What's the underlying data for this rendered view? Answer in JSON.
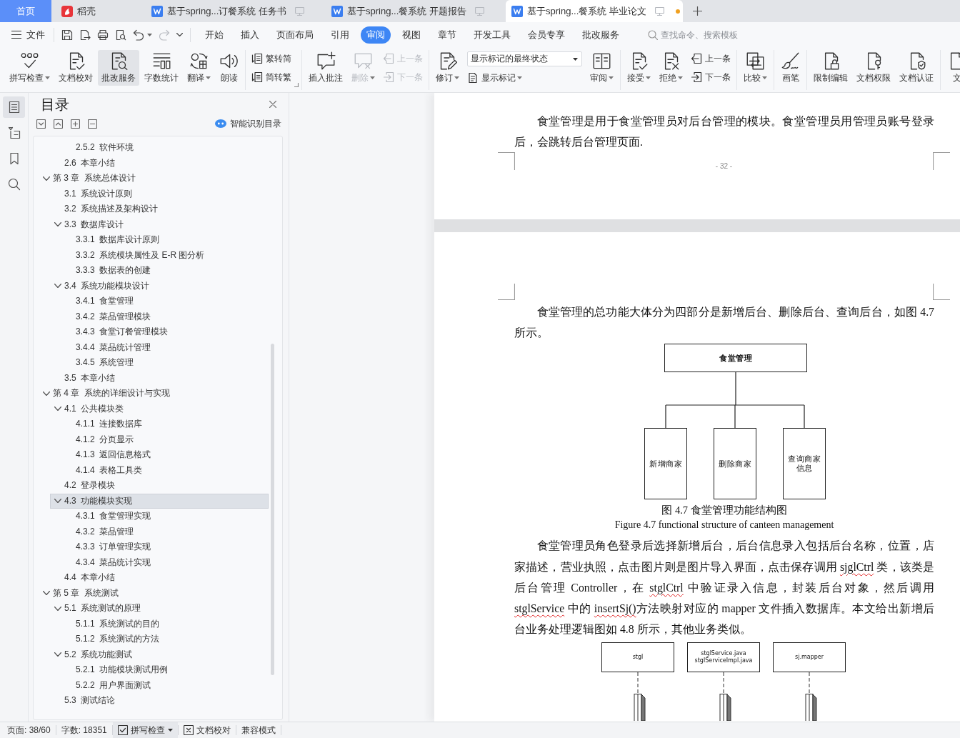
{
  "tabs": [
    {
      "kind": "home",
      "label": "首页",
      "selected": false
    },
    {
      "kind": "docer",
      "label": "稻壳",
      "selected": false
    },
    {
      "kind": "document",
      "label": "基于spring...订餐系统 任务书",
      "selected": false,
      "modified": false
    },
    {
      "kind": "document",
      "label": "基于spring...餐系统 开题报告",
      "selected": false,
      "modified": false
    },
    {
      "kind": "document",
      "label": "基于spring...餐系统 毕业论文",
      "selected": true,
      "modified": true
    }
  ],
  "menu": {
    "file": "文件",
    "quick_access": [
      {
        "dropdown": false,
        "disabled": false
      },
      {
        "dropdown": false,
        "disabled": false
      },
      {
        "dropdown": false,
        "disabled": false
      },
      {
        "dropdown": false,
        "disabled": false
      },
      {
        "dropdown": true,
        "disabled": false
      },
      {
        "dropdown": false,
        "disabled": true
      }
    ],
    "tabs": [
      {
        "label": "开始",
        "selected": false
      },
      {
        "label": "插入",
        "selected": false
      },
      {
        "label": "页面布局",
        "selected": false
      },
      {
        "label": "引用",
        "selected": false
      },
      {
        "label": "审阅",
        "selected": true
      },
      {
        "label": "视图",
        "selected": false
      },
      {
        "label": "章节",
        "selected": false
      },
      {
        "label": "开发工具",
        "selected": false
      },
      {
        "label": "会员专享",
        "selected": false
      },
      {
        "label": "批改服务",
        "selected": false
      }
    ],
    "search": {
      "placeholder": "查找命令、搜索模板"
    }
  },
  "ribbon": {
    "groups": [
      {
        "launcher": false,
        "items": [
          {
            "kind": "large",
            "label": "拼写检查",
            "dropdown": true,
            "disabled": false,
            "hovered": false
          },
          {
            "kind": "large",
            "label": "文档校对",
            "dropdown": false,
            "disabled": false,
            "hovered": false
          },
          {
            "kind": "large",
            "label": "批改服务",
            "dropdown": false,
            "disabled": false,
            "hovered": true
          },
          {
            "kind": "large",
            "label": "字数统计",
            "dropdown": false,
            "disabled": false,
            "hovered": false
          },
          {
            "kind": "large",
            "label": "翻译",
            "dropdown": true,
            "disabled": false,
            "hovered": false
          },
          {
            "kind": "large",
            "label": "朗读",
            "dropdown": false,
            "disabled": false,
            "hovered": false
          }
        ]
      },
      {
        "launcher": true,
        "items": [
          {
            "kind": "stack",
            "items": [
              {
                "kind": "small",
                "label": "繁转简",
                "dropdown": false,
                "disabled": false,
                "hovered": false
              },
              {
                "kind": "small",
                "label": "简转繁",
                "dropdown": false,
                "disabled": false,
                "hovered": false
              }
            ]
          }
        ]
      },
      {
        "launcher": false,
        "items": [
          {
            "kind": "large",
            "label": "插入批注",
            "dropdown": false,
            "disabled": false,
            "hovered": false
          },
          {
            "kind": "large",
            "label": "删除",
            "dropdown": true,
            "disabled": true,
            "hovered": false
          },
          {
            "kind": "stack",
            "items": [
              {
                "kind": "small",
                "label": "上一条",
                "dropdown": false,
                "disabled": true,
                "hovered": false
              },
              {
                "kind": "small",
                "label": "下一条",
                "dropdown": false,
                "disabled": true,
                "hovered": false
              }
            ]
          }
        ]
      },
      {
        "launcher": false,
        "items": [
          {
            "kind": "large",
            "label": "修订",
            "dropdown": true,
            "disabled": false,
            "hovered": false
          },
          {
            "kind": "stack",
            "items": [
              {
                "kind": "select",
                "value": "显示标记的最终状态"
              },
              {
                "kind": "small",
                "label": "显示标记",
                "dropdown": true,
                "disabled": false,
                "hovered": false
              }
            ]
          },
          {
            "kind": "large",
            "label": "审阅",
            "dropdown": true,
            "disabled": false,
            "hovered": false
          }
        ]
      },
      {
        "launcher": false,
        "items": [
          {
            "kind": "large",
            "label": "接受",
            "dropdown": true,
            "disabled": false,
            "hovered": false
          },
          {
            "kind": "large",
            "label": "拒绝",
            "dropdown": true,
            "disabled": false,
            "hovered": false
          },
          {
            "kind": "stack",
            "items": [
              {
                "kind": "small",
                "label": "上一条",
                "dropdown": false,
                "disabled": false,
                "hovered": false
              },
              {
                "kind": "small",
                "label": "下一条",
                "dropdown": false,
                "disabled": false,
                "hovered": false
              }
            ]
          }
        ]
      },
      {
        "launcher": false,
        "items": [
          {
            "kind": "large",
            "label": "比较",
            "dropdown": true,
            "disabled": false,
            "hovered": false
          }
        ]
      },
      {
        "launcher": false,
        "items": [
          {
            "kind": "large",
            "label": "画笔",
            "dropdown": false,
            "disabled": false,
            "hovered": false
          }
        ]
      },
      {
        "launcher": false,
        "items": [
          {
            "kind": "large",
            "label": "限制编辑",
            "dropdown": false,
            "disabled": false,
            "hovered": false
          },
          {
            "kind": "large",
            "label": "文档权限",
            "dropdown": false,
            "disabled": false,
            "hovered": false
          },
          {
            "kind": "large",
            "label": "文档认证",
            "dropdown": false,
            "disabled": false,
            "hovered": false
          }
        ]
      },
      {
        "launcher": false,
        "items": [
          {
            "kind": "large",
            "label": "文",
            "dropdown": false,
            "disabled": false,
            "hovered": false
          }
        ]
      }
    ]
  },
  "nav_rail": [
    {
      "selected": true
    },
    {
      "selected": false
    },
    {
      "selected": false
    },
    {
      "selected": false
    }
  ],
  "toc_panel": {
    "title": "目录",
    "smart_button": "智能识别目录",
    "items": [
      {
        "children": [
          {
            "children": [
              {
                "number": "2.5.2",
                "title": "软件环境",
                "selected": false
              }
            ]
          },
          {
            "number": "2.6",
            "title": "本章小结",
            "selected": false
          }
        ]
      },
      {
        "number": "第 3 章",
        "title": "系统总体设计",
        "selected": false,
        "expanded": true,
        "children": [
          {
            "number": "3.1",
            "title": "系统设计原则",
            "selected": false
          },
          {
            "number": "3.2",
            "title": "系统描述及架构设计",
            "selected": false
          },
          {
            "number": "3.3",
            "title": "数据库设计",
            "selected": false,
            "expanded": true,
            "children": [
              {
                "number": "3.3.1",
                "title": "数据库设计原则",
                "selected": false
              },
              {
                "number": "3.3.2",
                "title": "系统模块属性及 E-R 图分析",
                "selected": false
              },
              {
                "number": "3.3.3",
                "title": "数据表的创建",
                "selected": false
              }
            ]
          },
          {
            "number": "3.4",
            "title": "系统功能模块设计",
            "selected": false,
            "expanded": true,
            "children": [
              {
                "number": "3.4.1",
                "title": "食堂管理",
                "selected": false
              },
              {
                "number": "3.4.2",
                "title": "菜品管理模块",
                "selected": false
              },
              {
                "number": "3.4.3",
                "title": "食堂订餐管理模块",
                "selected": false
              },
              {
                "number": "3.4.4",
                "title": "菜品统计管理",
                "selected": false
              },
              {
                "number": "3.4.5",
                "title": "系统管理",
                "selected": false
              }
            ]
          },
          {
            "number": "3.5",
            "title": "本章小结",
            "selected": false
          }
        ]
      },
      {
        "number": "第 4 章",
        "title": "系统的详细设计与实现",
        "selected": false,
        "expanded": true,
        "children": [
          {
            "number": "4.1",
            "title": "公共模块类",
            "selected": false,
            "expanded": true,
            "children": [
              {
                "number": "4.1.1",
                "title": "连接数据库",
                "selected": false
              },
              {
                "number": "4.1.2",
                "title": "分页显示",
                "selected": false
              },
              {
                "number": "4.1.3",
                "title": "返回信息格式",
                "selected": false
              },
              {
                "number": "4.1.4",
                "title": "表格工具类",
                "selected": false
              }
            ]
          },
          {
            "number": "4.2",
            "title": "登录模块",
            "selected": false
          },
          {
            "number": "4.3",
            "title": "功能模块实现",
            "selected": true,
            "expanded": true,
            "children": [
              {
                "number": "4.3.1",
                "title": "食堂管理实现",
                "selected": false
              },
              {
                "number": "4.3.2",
                "title": "菜品管理",
                "selected": false
              },
              {
                "number": "4.3.3",
                "title": "订单管理实现",
                "selected": false
              },
              {
                "number": "4.3.4",
                "title": "菜品统计实现",
                "selected": false
              }
            ]
          },
          {
            "number": "4.4",
            "title": "本章小结",
            "selected": false
          }
        ]
      },
      {
        "number": "第 5 章",
        "title": "系统测试",
        "selected": false,
        "expanded": true,
        "children": [
          {
            "number": "5.1",
            "title": "系统测试的原理",
            "selected": false,
            "expanded": true,
            "children": [
              {
                "number": "5.1.1",
                "title": "系统测试的目的",
                "selected": false
              },
              {
                "number": "5.1.2",
                "title": "系统测试的方法",
                "selected": false
              }
            ]
          },
          {
            "number": "5.2",
            "title": "系统功能测试",
            "selected": false,
            "expanded": true,
            "children": [
              {
                "number": "5.2.1",
                "title": "功能模块测试用例",
                "selected": false
              },
              {
                "number": "5.2.2",
                "title": "用户界面测试",
                "selected": false
              }
            ]
          },
          {
            "number": "5.3",
            "title": "测试结论",
            "selected": false
          }
        ]
      }
    ]
  },
  "document": {
    "pages": [
      {
        "kind": "page_end",
        "page_number": "- 32 -",
        "blocks": [
          {
            "kind": "paragraph",
            "segments": [
              {
                "text": "食堂管理是用于食堂管理员对后台管理的模块。食堂管理员用管理员账号登录后，会跳转后台管理页面.",
                "flagged": false
              }
            ]
          }
        ]
      },
      {
        "kind": "page_start",
        "blocks": [
          {
            "kind": "paragraph",
            "segments": [
              {
                "text": "食堂管理的总功能大体分为四部分是新增后台、删除后台、查询后台，如图 4.7 所示。",
                "flagged": false
              }
            ]
          },
          {
            "kind": "tree_diagram",
            "root": "食堂管理",
            "children": [
              "新增商家",
              "删除商家",
              "查询商家信息"
            ]
          },
          {
            "kind": "caption",
            "text": "图 4.7 食堂管理功能结构图"
          },
          {
            "kind": "subcaption",
            "text": "Figure 4.7 functional structure of canteen management"
          },
          {
            "kind": "paragraph",
            "segments": [
              {
                "text": "食堂管理员角色登录后选择新增后台，后台信息录入包括后台名称，位置，店家描述，营业执照，点击图片则是图片导入界面，点击保存调用 ",
                "flagged": false
              },
              {
                "text": "sjglCtrl",
                "flagged": true
              },
              {
                "text": " 类，该类是后台管理 Controller，在 ",
                "flagged": false
              },
              {
                "text": "stglCtrl",
                "flagged": true
              },
              {
                "text": " 中验证录入信息，封装后台对象，然后调用 ",
                "flagged": false
              },
              {
                "text": "stglService",
                "flagged": true
              },
              {
                "text": " 中的 ",
                "flagged": false
              },
              {
                "text": "insertSj()",
                "flagged": true
              },
              {
                "text": "方法映射对应的 mapper 文件插入数据库。本文给出新增后台业务处理逻辑图如 4.8 所示，其他业务类似。",
                "flagged": false
              }
            ]
          },
          {
            "kind": "sequence_diagram",
            "participants": [
              {
                "lines": [
                  "stgl"
                ]
              },
              {
                "lines": [
                  "stglService.java",
                  "stglServiceImpl.java"
                ]
              },
              {
                "lines": [
                  "sj.mapper"
                ]
              }
            ]
          }
        ]
      }
    ]
  },
  "status_bar": {
    "page": "页面: 38/60",
    "word_count": "字数: 18351",
    "spell_check": {
      "label": "拼写检查",
      "checked": true
    },
    "proofread": "文档校对",
    "mode": "兼容模式"
  }
}
